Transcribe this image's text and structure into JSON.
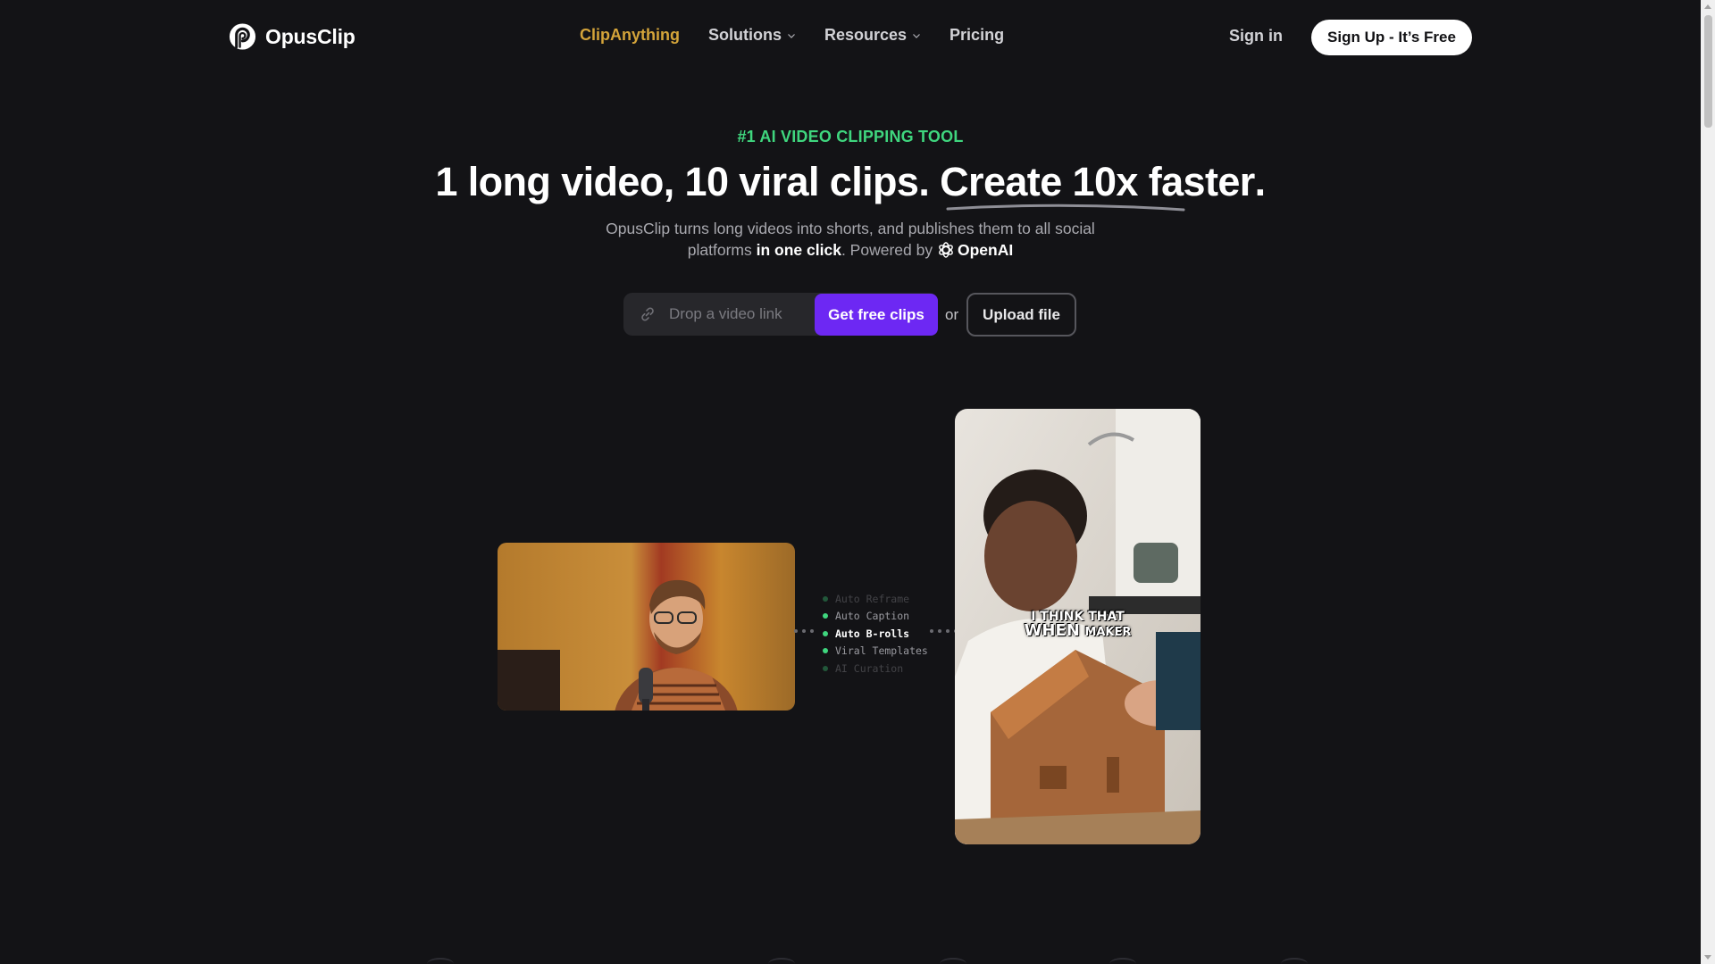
{
  "header": {
    "brand": "OpusClip",
    "nav": [
      {
        "label": "ClipAnything",
        "active": true
      },
      {
        "label": "Solutions",
        "dropdown": true
      },
      {
        "label": "Resources",
        "dropdown": true
      },
      {
        "label": "Pricing"
      }
    ],
    "signin_label": "Sign in",
    "signup_label": "Sign Up - It’s Free"
  },
  "hero": {
    "tagline": "#1 AI VIDEO CLIPPING TOOL",
    "headline_prefix": "1 long video, 10 viral clips.",
    "headline_highlight": "Create 10x faster",
    "headline_suffix": ".",
    "sub_line1": "OpusClip turns long videos into shorts, and publishes them to all social",
    "sub_line2_a": "platforms",
    "sub_line2_bold": "in one click",
    "sub_line2_b": ". Powered by",
    "powered_by": "OpenAI"
  },
  "cta": {
    "input_placeholder": "Drop a video link",
    "get_clips_label": "Get free clips",
    "or_label": "or",
    "upload_label": "Upload file"
  },
  "demo": {
    "features": [
      {
        "label": "Auto Reframe",
        "state": "faded"
      },
      {
        "label": "Auto Caption",
        "state": "normal"
      },
      {
        "label": "Auto B-rolls",
        "state": "active"
      },
      {
        "label": "Viral Templates",
        "state": "normal"
      },
      {
        "label": "AI Curation",
        "state": "faded"
      }
    ],
    "caption_line1": "I THINK THAT",
    "caption_line2_big": "WHEN",
    "caption_line2_small": "MAKER"
  },
  "colors": {
    "background": "#131316",
    "accent_purple": "#6d28f3",
    "tagline_green": "#3fd67e",
    "active_nav_gold": "#d4a43a"
  },
  "icons": [
    "opusclip-logo-icon",
    "chevron-down-icon",
    "openai-icon",
    "link-icon"
  ]
}
